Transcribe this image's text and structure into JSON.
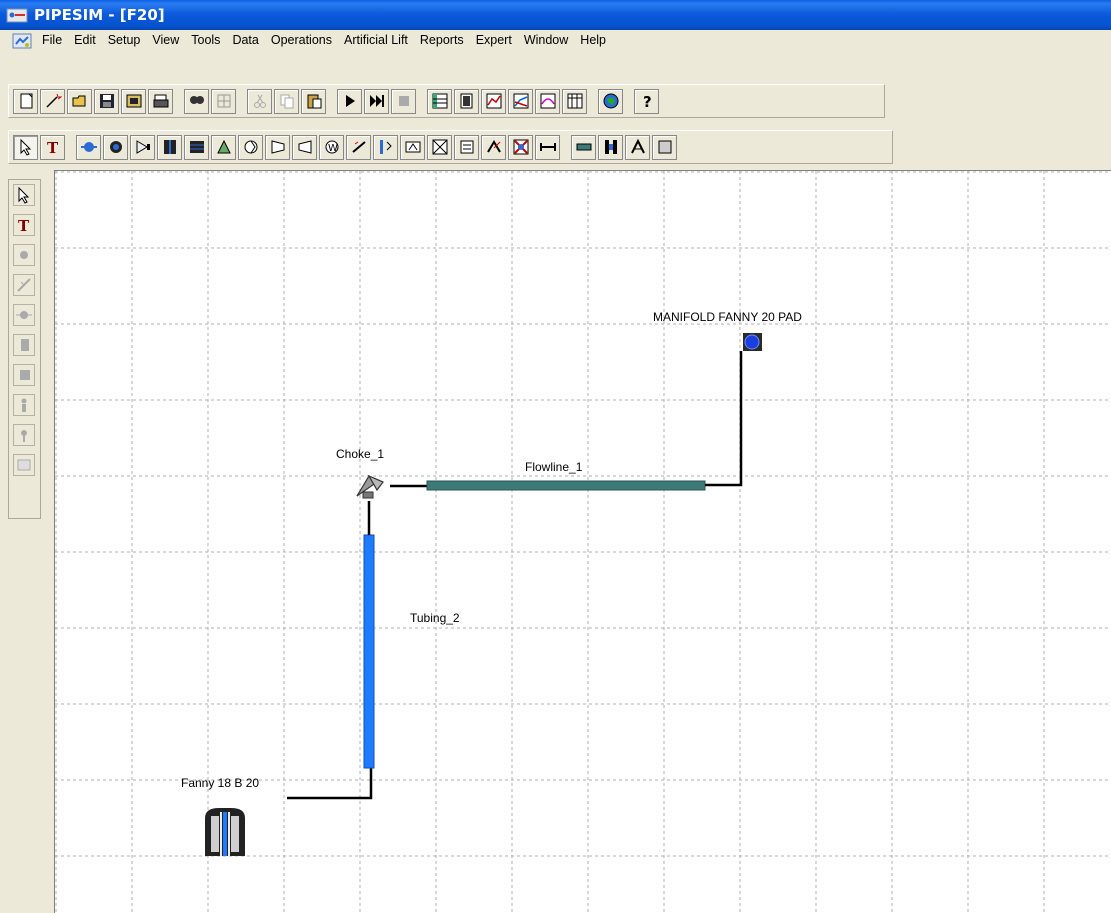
{
  "window": {
    "title": "PIPESIM - [F20]"
  },
  "menu": {
    "items": [
      "File",
      "Edit",
      "Setup",
      "View",
      "Tools",
      "Data",
      "Operations",
      "Artificial Lift",
      "Reports",
      "Expert",
      "Window",
      "Help"
    ]
  },
  "toolbar_main": {
    "icons": [
      "new-icon",
      "wand-icon",
      "open-icon",
      "save-icon",
      "print-setup-icon",
      "print-icon",
      "find-icon",
      "grid-icon",
      "cut-icon",
      "copy-icon",
      "paste-icon",
      "run-icon",
      "run-all-icon",
      "stop-icon",
      "table-icon",
      "report-icon",
      "graph-icon",
      "profile-icon",
      "output-graph-icon",
      "spreadsheet-icon",
      "globe-icon",
      "help-icon"
    ]
  },
  "toolbar_objects": {
    "icons": [
      "select-icon",
      "text-tool-icon",
      "source-icon",
      "sink-icon",
      "injection-point-icon",
      "well-icon",
      "multi-well-icon",
      "choke-tool-icon",
      "pump-icon",
      "compressor-icon",
      "expander-icon",
      "separator-icon",
      "heater-icon",
      "meter-icon",
      "check-valve-icon",
      "junction-icon",
      "riser-icon",
      "report-tool-icon",
      "engine-icon",
      "multiplier-icon",
      "flowline-tool-icon",
      "tubing-tool-icon",
      "connector-icon",
      "node-icon"
    ]
  },
  "palette": {
    "icons": [
      "select-icon",
      "text-icon",
      "source-disabled-icon",
      "line-disabled-icon",
      "node-disabled-icon",
      "well-disabled-icon",
      "multi-well-disabled-icon",
      "person-disabled-icon",
      "injector-disabled-icon",
      "keypad-disabled-icon"
    ]
  },
  "diagram": {
    "manifold_label": "MANIFOLD FANNY 20 PAD",
    "choke_label": "Choke_1",
    "flowline_label": "Flowline_1",
    "tubing_label": "Tubing_2",
    "well_label": "Fanny 18 B 20"
  },
  "colors": {
    "titlebar": "#0553d0",
    "flowline": "#3c7a78",
    "tubing": "#1e7bff",
    "manifold": "#1a3fe0"
  }
}
